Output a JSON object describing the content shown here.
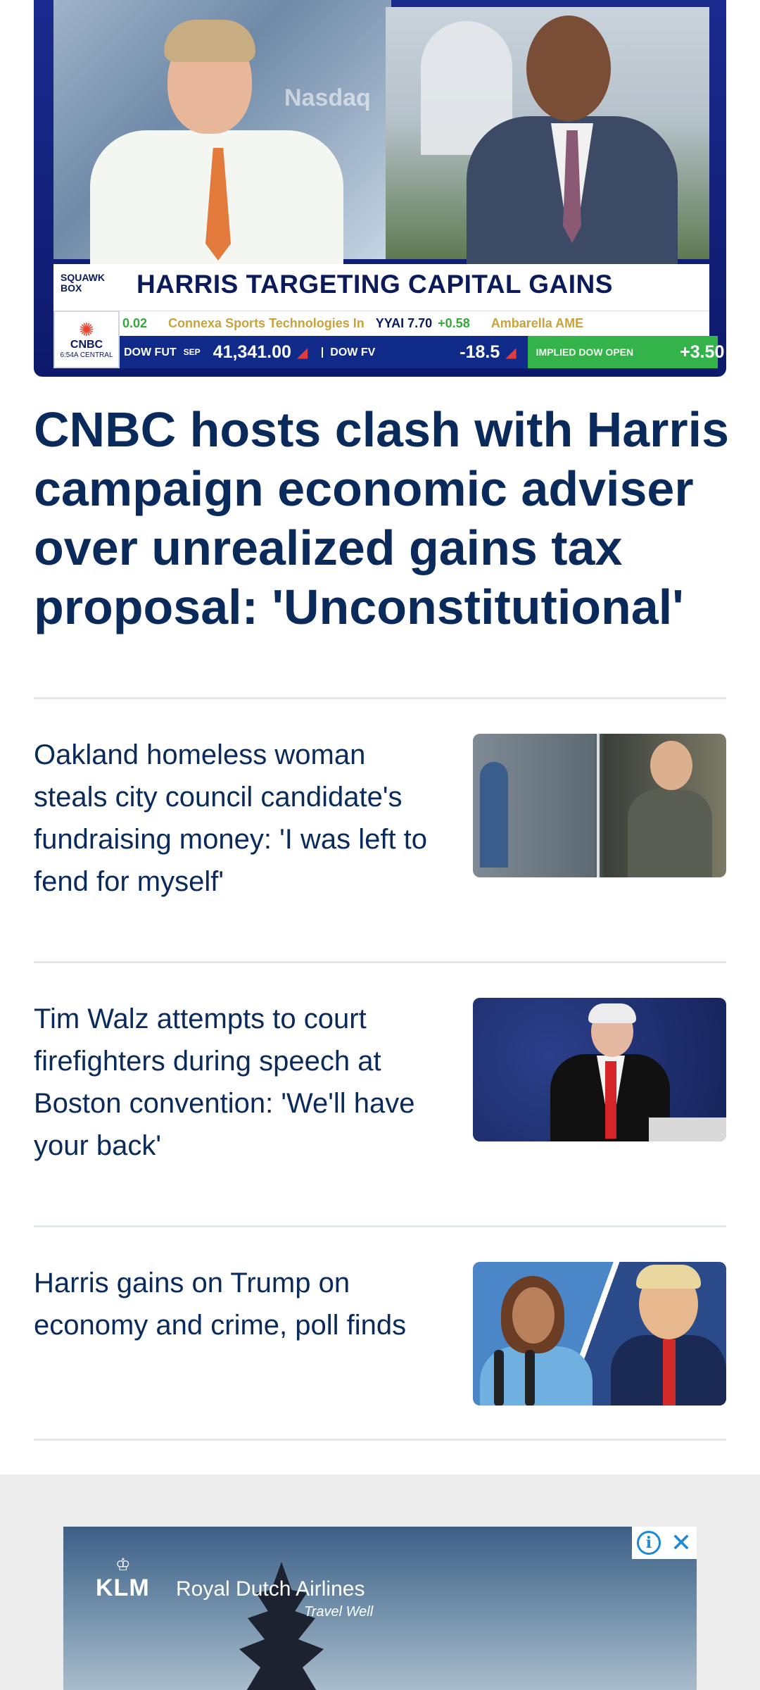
{
  "hero": {
    "watermark": "Nasdaq",
    "show_label": "SQUAWK BOX",
    "banner": "HARRIS TARGETING CAPITAL GAINS",
    "network": "CNBC",
    "time": "6:54A CENTRAL",
    "ticker": {
      "pct": "0.02",
      "company": "Connexa Sports Technologies In",
      "symbol_value": "YYAI 7.70",
      "change": "+0.58",
      "next": "Ambarella AME"
    },
    "market": {
      "dow_fut_label": "DOW FUT",
      "dow_fut_month": "SEP",
      "dow_fut_value": "41,341.00",
      "dow_fv_label": "DOW FV",
      "dow_fv_value": "-18.5",
      "implied_label": "IMPLIED DOW OPEN",
      "implied_value": "+3.50"
    }
  },
  "main_headline": "CNBC hosts clash with Harris campaign economic adviser over unrealized gains tax proposal: 'Unconstitutional'",
  "stories": [
    {
      "title": "Oakland homeless woman steals city council candidate's fundraising money: 'I was left to fend for myself'"
    },
    {
      "title": "Tim Walz attempts to court firefighters during speech at Boston convention: 'We'll have your back'"
    },
    {
      "title": "Harris gains on Trump on economy and crime, poll finds"
    }
  ],
  "ad": {
    "brand": "KLM",
    "name": "Royal Dutch Airlines",
    "tagline": "Travel Well",
    "info_glyph": "i",
    "close_glyph": "✕"
  }
}
